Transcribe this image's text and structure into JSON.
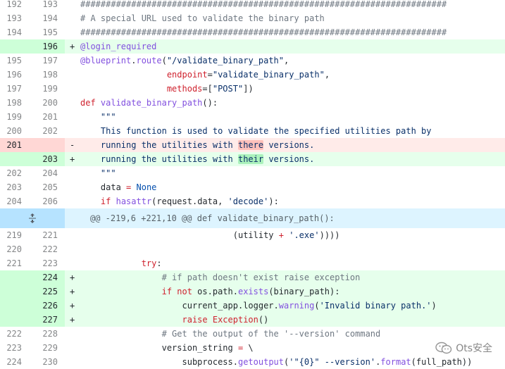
{
  "colors": {
    "add_bg": "#e6ffec",
    "add_num_bg": "#cdffd8",
    "del_bg": "#ffebe9",
    "del_num_bg": "#ffd7d5",
    "hunk_bg": "#ddf4ff",
    "keyword": "#cf222e",
    "function": "#8250df",
    "string": "#0a3069",
    "comment": "#6e7781"
  },
  "icons": {
    "expand": "unfold-icon",
    "watermark": "wechat-logo-icon"
  },
  "lines": [
    {
      "old": "192",
      "new": "193",
      "marker": "",
      "tokens": [
        {
          "t": "########################################################################",
          "c": "cm"
        }
      ]
    },
    {
      "old": "193",
      "new": "194",
      "marker": "",
      "tokens": [
        {
          "t": "# A special URL used to validate the binary path",
          "c": "cm"
        }
      ]
    },
    {
      "old": "194",
      "new": "195",
      "marker": "",
      "tokens": [
        {
          "t": "########################################################################",
          "c": "cm"
        }
      ]
    },
    {
      "old": "",
      "new": "196",
      "marker": "+",
      "type": "add",
      "tokens": [
        {
          "t": "@login_required",
          "c": "fn"
        }
      ]
    },
    {
      "old": "195",
      "new": "197",
      "marker": "",
      "tokens": [
        {
          "t": "@blueprint",
          "c": "fn"
        },
        {
          "t": ".",
          "c": "ctx"
        },
        {
          "t": "route",
          "c": "fn"
        },
        {
          "t": "(",
          "c": "ctx"
        },
        {
          "t": "\"/validate_binary_path\"",
          "c": "str"
        },
        {
          "t": ",",
          "c": "ctx"
        }
      ]
    },
    {
      "old": "196",
      "new": "198",
      "marker": "",
      "tokens": [
        {
          "t": "                 ",
          "c": "ctx"
        },
        {
          "t": "endpoint",
          "c": "kw"
        },
        {
          "t": "=",
          "c": "ctx"
        },
        {
          "t": "\"validate_binary_path\"",
          "c": "str"
        },
        {
          "t": ",",
          "c": "ctx"
        }
      ]
    },
    {
      "old": "197",
      "new": "199",
      "marker": "",
      "tokens": [
        {
          "t": "                 ",
          "c": "ctx"
        },
        {
          "t": "methods",
          "c": "kw"
        },
        {
          "t": "=[",
          "c": "ctx"
        },
        {
          "t": "\"POST\"",
          "c": "str"
        },
        {
          "t": "])",
          "c": "ctx"
        }
      ]
    },
    {
      "old": "198",
      "new": "200",
      "marker": "",
      "tokens": [
        {
          "t": "def ",
          "c": "kw"
        },
        {
          "t": "validate_binary_path",
          "c": "fn"
        },
        {
          "t": "():",
          "c": "ctx"
        }
      ]
    },
    {
      "old": "199",
      "new": "201",
      "marker": "",
      "tokens": [
        {
          "t": "    \"\"\"",
          "c": "str"
        }
      ]
    },
    {
      "old": "200",
      "new": "202",
      "marker": "",
      "tokens": [
        {
          "t": "    This function is used to validate the specified utilities path by",
          "c": "str"
        }
      ]
    },
    {
      "old": "201",
      "new": "",
      "marker": "-",
      "type": "del",
      "tokens": [
        {
          "t": "    running the utilities with ",
          "c": "str"
        },
        {
          "t": "there",
          "c": "str",
          "hl": "del"
        },
        {
          "t": " versions.",
          "c": "str"
        }
      ]
    },
    {
      "old": "",
      "new": "203",
      "marker": "+",
      "type": "add",
      "tokens": [
        {
          "t": "    running the utilities with ",
          "c": "str"
        },
        {
          "t": "their",
          "c": "str",
          "hl": "add"
        },
        {
          "t": " versions.",
          "c": "str"
        }
      ]
    },
    {
      "old": "202",
      "new": "204",
      "marker": "",
      "tokens": [
        {
          "t": "    \"\"\"",
          "c": "str"
        }
      ]
    },
    {
      "old": "203",
      "new": "205",
      "marker": "",
      "tokens": [
        {
          "t": "    data ",
          "c": "ctx"
        },
        {
          "t": "=",
          "c": "kw"
        },
        {
          "t": " ",
          "c": "ctx"
        },
        {
          "t": "None",
          "c": "op"
        }
      ]
    },
    {
      "old": "204",
      "new": "206",
      "marker": "",
      "tokens": [
        {
          "t": "    ",
          "c": "ctx"
        },
        {
          "t": "if ",
          "c": "kw"
        },
        {
          "t": "hasattr",
          "c": "fn"
        },
        {
          "t": "(request.data, ",
          "c": "ctx"
        },
        {
          "t": "'decode'",
          "c": "str"
        },
        {
          "t": "):",
          "c": "ctx"
        }
      ]
    },
    {
      "type": "hunk",
      "text": "@@ -219,6 +221,10 @@ def validate_binary_path():"
    },
    {
      "old": "219",
      "new": "221",
      "marker": "",
      "tokens": [
        {
          "t": "                              (utility ",
          "c": "ctx"
        },
        {
          "t": "+",
          "c": "kw"
        },
        {
          "t": " ",
          "c": "ctx"
        },
        {
          "t": "'.exe'",
          "c": "str"
        },
        {
          "t": "))))",
          "c": "ctx"
        }
      ]
    },
    {
      "old": "220",
      "new": "222",
      "marker": "",
      "tokens": [
        {
          "t": "",
          "c": "ctx"
        }
      ]
    },
    {
      "old": "221",
      "new": "223",
      "marker": "",
      "tokens": [
        {
          "t": "            ",
          "c": "ctx"
        },
        {
          "t": "try",
          "c": "kw"
        },
        {
          "t": ":",
          "c": "ctx"
        }
      ]
    },
    {
      "old": "",
      "new": "224",
      "marker": "+",
      "type": "add",
      "tokens": [
        {
          "t": "                ",
          "c": "ctx"
        },
        {
          "t": "# if path doesn't exist raise exception",
          "c": "cm"
        }
      ]
    },
    {
      "old": "",
      "new": "225",
      "marker": "+",
      "type": "add",
      "tokens": [
        {
          "t": "                ",
          "c": "ctx"
        },
        {
          "t": "if not ",
          "c": "kw"
        },
        {
          "t": "os.path.",
          "c": "ctx"
        },
        {
          "t": "exists",
          "c": "fn"
        },
        {
          "t": "(binary_path):",
          "c": "ctx"
        }
      ]
    },
    {
      "old": "",
      "new": "226",
      "marker": "+",
      "type": "add",
      "tokens": [
        {
          "t": "                    current_app.logger.",
          "c": "ctx"
        },
        {
          "t": "warning",
          "c": "fn"
        },
        {
          "t": "(",
          "c": "ctx"
        },
        {
          "t": "'Invalid binary path.'",
          "c": "str"
        },
        {
          "t": ")",
          "c": "ctx"
        }
      ]
    },
    {
      "old": "",
      "new": "227",
      "marker": "+",
      "type": "add",
      "tokens": [
        {
          "t": "                    ",
          "c": "ctx"
        },
        {
          "t": "raise ",
          "c": "kw"
        },
        {
          "t": "Exception",
          "c": "kw"
        },
        {
          "t": "()",
          "c": "ctx"
        }
      ]
    },
    {
      "old": "222",
      "new": "228",
      "marker": "",
      "tokens": [
        {
          "t": "                ",
          "c": "ctx"
        },
        {
          "t": "# Get the output of the '--version' command",
          "c": "cm"
        }
      ]
    },
    {
      "old": "223",
      "new": "229",
      "marker": "",
      "tokens": [
        {
          "t": "                version_string ",
          "c": "ctx"
        },
        {
          "t": "=",
          "c": "kw"
        },
        {
          "t": " \\",
          "c": "ctx"
        }
      ]
    },
    {
      "old": "224",
      "new": "230",
      "marker": "",
      "tokens": [
        {
          "t": "                    subprocess.",
          "c": "ctx"
        },
        {
          "t": "getoutput",
          "c": "fn"
        },
        {
          "t": "(",
          "c": "ctx"
        },
        {
          "t": "'\"{0}\" --version'",
          "c": "str"
        },
        {
          "t": ".",
          "c": "ctx"
        },
        {
          "t": "format",
          "c": "fn"
        },
        {
          "t": "(full_path))",
          "c": "ctx"
        }
      ]
    }
  ],
  "watermark": {
    "text": "Ots安全"
  }
}
